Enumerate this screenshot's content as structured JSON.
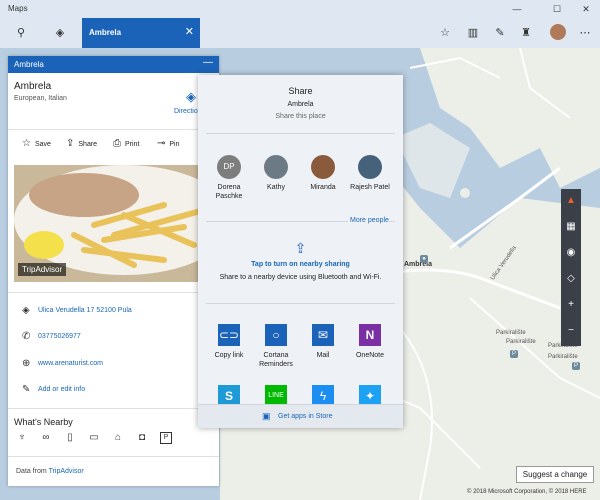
{
  "window": {
    "title": "Maps",
    "minimize": "—",
    "maximize": "☐",
    "close": "✕"
  },
  "toolbar": {
    "tab_label": "Ambrela",
    "tab_close": "✕"
  },
  "panel": {
    "header_title": "Ambrela",
    "place_name": "Ambrela",
    "cuisine": "European, Italian",
    "directions_label": "Directions",
    "actions": {
      "save": "Save",
      "share": "Share",
      "print": "Print",
      "pin": "Pin"
    },
    "photo_credit": "TripAdvisor",
    "address": "Ulica Verudella 17 52100 Pula",
    "phone": "03775026977",
    "website": "www.arenaturist.com",
    "add_info": "Add or edit info",
    "whats_nearby": "What's Nearby",
    "data_from_label": "Data from",
    "data_from_source": "TripAdvisor"
  },
  "share": {
    "title": "Share",
    "place": "Ambrela",
    "subtitle": "Share this place",
    "people": [
      {
        "initials": "DP",
        "name_line1": "Dorena",
        "name_line2": "Paschke",
        "color": "#7d7d7d"
      },
      {
        "initials": "",
        "name_line1": "Kathy",
        "name_line2": "",
        "color": "#6b7a85"
      },
      {
        "initials": "",
        "name_line1": "Miranda",
        "name_line2": "",
        "color": "#8a5a3c"
      },
      {
        "initials": "",
        "name_line1": "Rajesh Patel",
        "name_line2": "",
        "color": "#46617a"
      }
    ],
    "more_people": "More people",
    "nearby_title": "Tap to turn on nearby sharing",
    "nearby_desc": "Share to a nearby device using Bluetooth and Wi-Fi.",
    "apps": [
      {
        "name_line1": "Copy link",
        "name_line2": "",
        "color": "#1b63b8",
        "icon": "link-icon"
      },
      {
        "name_line1": "Cortana",
        "name_line2": "Reminders",
        "color": "#1b63b8",
        "icon": "cortana-icon"
      },
      {
        "name_line1": "Mail",
        "name_line2": "",
        "color": "#1b63b8",
        "icon": "mail-icon"
      },
      {
        "name_line1": "OneNote",
        "name_line2": "",
        "color": "#7b2fa5",
        "icon": "onenote-icon"
      }
    ],
    "apps_row2_colors": [
      "#1e9bd6",
      "#00b900",
      "#1b8ef2",
      "#1da1f2"
    ],
    "get_apps": "Get apps in Store"
  },
  "map": {
    "label_ambrela": "Ambrela",
    "label_ulica": "Ulica Verudella",
    "parking": [
      "Parkiralište",
      "Parkiralište",
      "Parkiralište",
      "Parkiralište"
    ],
    "suggest": "Suggest a change",
    "copyright": "© 2018 Microsoft Corporation, © 2018 HERE"
  },
  "colors": {
    "accent": "#1b63b8",
    "link": "#1a66b4",
    "water": "#b9cde0",
    "land": "#eceee8"
  }
}
